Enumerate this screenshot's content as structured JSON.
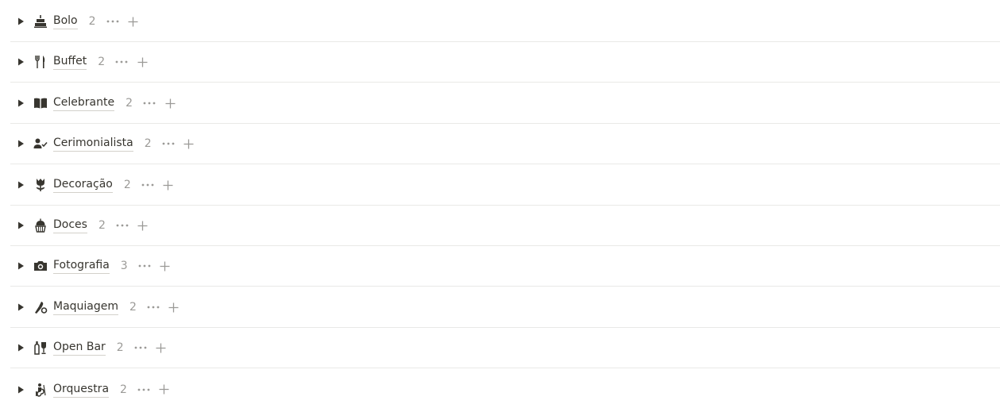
{
  "colors": {
    "text": "#37352f",
    "muted": "#9b9a97",
    "icon": "#37352f",
    "divider": "#e9e9e7"
  },
  "groups": [
    {
      "label": "Bolo",
      "count": "2",
      "icon": "cake-icon"
    },
    {
      "label": "Buffet",
      "count": "2",
      "icon": "fork-knife-icon"
    },
    {
      "label": "Celebrante",
      "count": "2",
      "icon": "open-book-icon"
    },
    {
      "label": "Cerimonialista",
      "count": "2",
      "icon": "person-check-icon"
    },
    {
      "label": "Decoração",
      "count": "2",
      "icon": "flower-icon"
    },
    {
      "label": "Doces",
      "count": "2",
      "icon": "cupcake-icon"
    },
    {
      "label": "Fotografia",
      "count": "3",
      "icon": "camera-icon"
    },
    {
      "label": "Maquiagem",
      "count": "2",
      "icon": "makeup-brush-icon"
    },
    {
      "label": "Open Bar",
      "count": "2",
      "icon": "wine-bottle-glass-icon"
    },
    {
      "label": "Orquestra",
      "count": "2",
      "icon": "violin-player-icon"
    }
  ]
}
